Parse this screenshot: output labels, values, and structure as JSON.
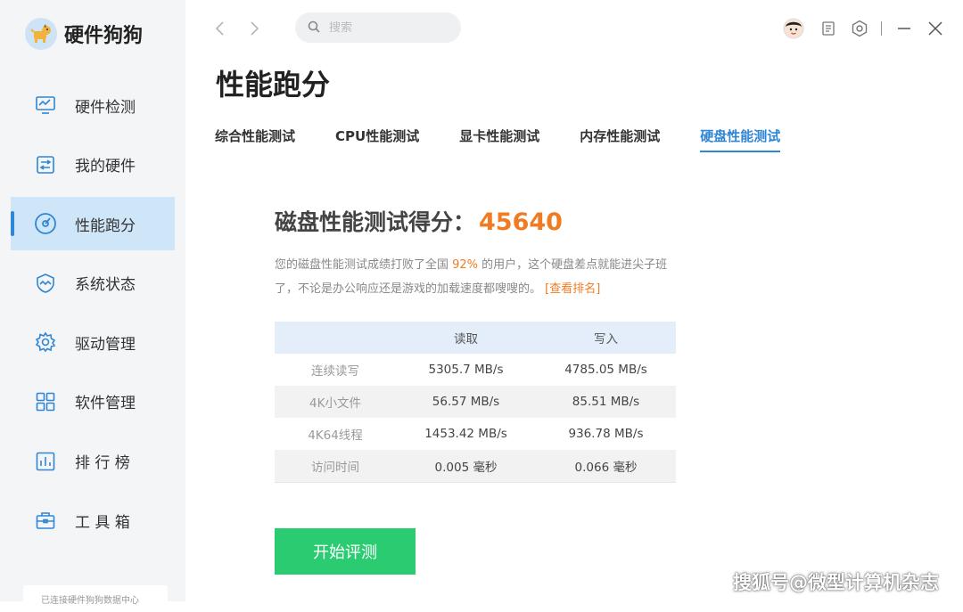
{
  "app": {
    "name": "硬件狗狗"
  },
  "sidebar": {
    "items": [
      {
        "label": "硬件检测",
        "icon": "monitor-icon"
      },
      {
        "label": "我的硬件",
        "icon": "hardware-icon"
      },
      {
        "label": "性能跑分",
        "icon": "gauge-icon",
        "active": true
      },
      {
        "label": "系统状态",
        "icon": "shield-icon"
      },
      {
        "label": "驱动管理",
        "icon": "gear-icon"
      },
      {
        "label": "软件管理",
        "icon": "apps-grid-icon"
      },
      {
        "label": "排 行 榜",
        "icon": "bar-chart-icon"
      },
      {
        "label": "工 具 箱",
        "icon": "toolbox-icon"
      }
    ],
    "bottom_text": "已连接硬件狗狗数据中心"
  },
  "search": {
    "placeholder": "搜索"
  },
  "page": {
    "title": "性能跑分"
  },
  "tabs": [
    {
      "label": "综合性能测试"
    },
    {
      "label": "CPU性能测试"
    },
    {
      "label": "显卡性能测试"
    },
    {
      "label": "内存性能测试"
    },
    {
      "label": "硬盘性能测试",
      "active": true
    }
  ],
  "result": {
    "score_label": "磁盘性能测试得分：",
    "score_value": "45640",
    "desc_before": "您的磁盘性能测试成绩打败了全国 ",
    "desc_percent": "92%",
    "desc_after": " 的用户，这个硬盘差点就能进尖子班了，不论是办公响应还是游戏的加载速度都嗖嗖的。 ",
    "rank_link": "[查看排名]"
  },
  "table": {
    "headers": [
      "",
      "读取",
      "写入"
    ],
    "rows": [
      [
        "连续读写",
        "5305.7 MB/s",
        "4785.05 MB/s"
      ],
      [
        "4K小文件",
        "56.57 MB/s",
        "85.51 MB/s"
      ],
      [
        "4K64线程",
        "1453.42 MB/s",
        "936.78 MB/s"
      ],
      [
        "访问时间",
        "0.005 毫秒",
        "0.066 毫秒"
      ]
    ]
  },
  "start_button": "开始评测",
  "watermark": "搜狐号@微型计算机杂志",
  "colors": {
    "accent": "#2f86d6",
    "score": "#f07b22",
    "button": "#2bcb72"
  }
}
